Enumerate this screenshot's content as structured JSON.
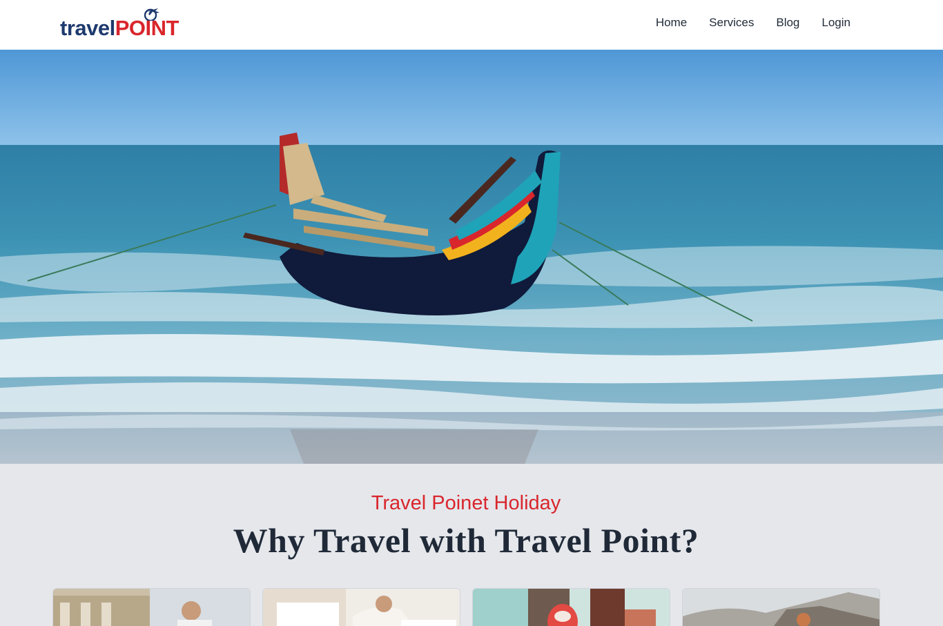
{
  "header": {
    "logo": {
      "word1": "travel",
      "word2": "POINT",
      "icon": "plane-icon"
    },
    "nav": [
      {
        "label": "Home"
      },
      {
        "label": "Services"
      },
      {
        "label": "Blog"
      },
      {
        "label": "Login"
      }
    ]
  },
  "hero": {
    "image": "beach-boat-photo"
  },
  "why": {
    "kicker": "Travel Poinet Holiday",
    "title": "Why Travel with Travel Point?",
    "cards": [
      {
        "image": "city-travelers-photo"
      },
      {
        "image": "laptop-desk-photo"
      },
      {
        "image": "luggage-photo"
      },
      {
        "image": "cliff-coast-photo"
      }
    ]
  },
  "colors": {
    "brand_navy": "#1e3a6e",
    "brand_red": "#d9262c",
    "section_bg": "#e5e7eb",
    "heading": "#1f2937"
  }
}
